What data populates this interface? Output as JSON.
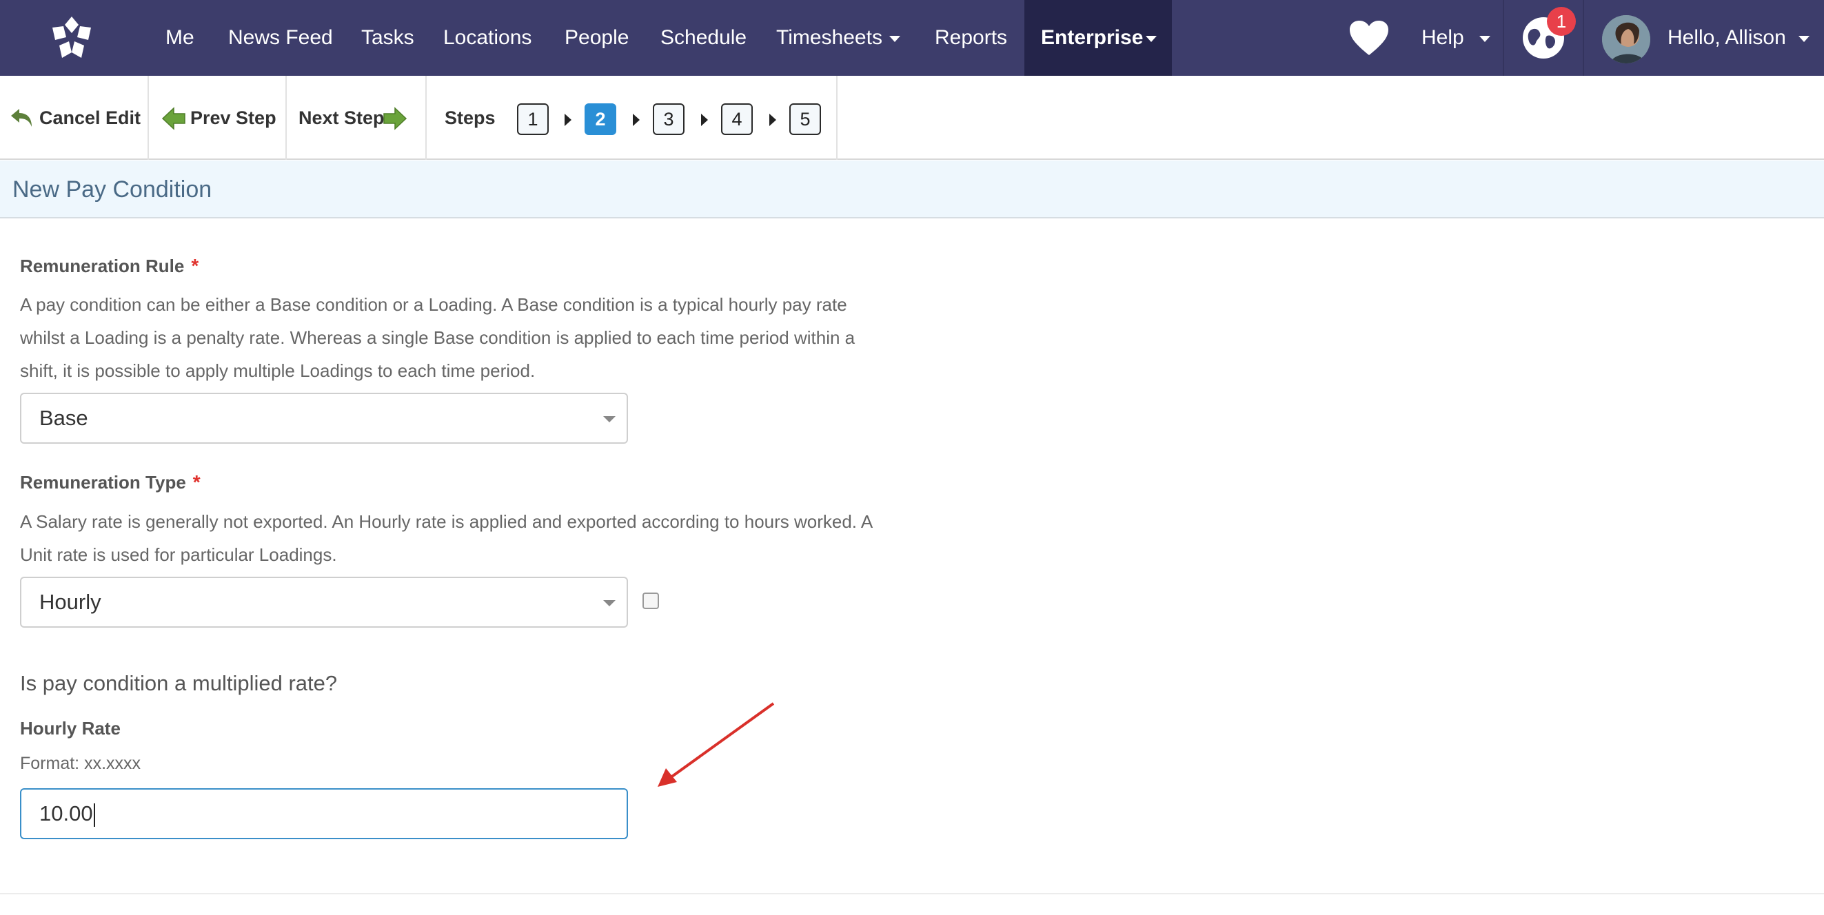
{
  "nav": {
    "items": [
      {
        "label": "Me"
      },
      {
        "label": "News Feed"
      },
      {
        "label": "Tasks"
      },
      {
        "label": "Locations"
      },
      {
        "label": "People"
      },
      {
        "label": "Schedule"
      },
      {
        "label": "Timesheets"
      },
      {
        "label": "Reports"
      },
      {
        "label": "Enterprise"
      }
    ],
    "help_label": "Help",
    "notifications_count": "1",
    "greeting": "Hello, Allison",
    "colors": {
      "bar": "#3d3d6b",
      "active": "#24244a",
      "badge": "#e8404a"
    }
  },
  "toolbar": {
    "cancel_label": "Cancel Edit",
    "prev_label": "Prev Step",
    "next_label": "Next Step",
    "steps_label": "Steps",
    "steps": [
      "1",
      "2",
      "3",
      "4",
      "5"
    ],
    "current_step": "2"
  },
  "page": {
    "title": "New Pay Condition"
  },
  "form": {
    "rule": {
      "label": "Remuneration Rule",
      "required_mark": "*",
      "help": "A pay condition can be either a Base condition or a Loading. A Base condition is a typical hourly pay rate whilst a Loading is a penalty rate. Whereas a single Base condition is applied to each time period within a shift, it is possible to apply multiple Loadings to each time period.",
      "value": "Base"
    },
    "type": {
      "label": "Remuneration Type",
      "required_mark": "*",
      "help": "A Salary rate is generally not exported. An Hourly rate is applied and exported according to hours worked. A Unit rate is used for particular Loadings.",
      "value": "Hourly"
    },
    "multiplied_question": "Is pay condition a multiplied rate?",
    "hourly_rate": {
      "label": "Hourly Rate",
      "format_hint": "Format: xx.xxxx",
      "value": "10.00"
    }
  }
}
